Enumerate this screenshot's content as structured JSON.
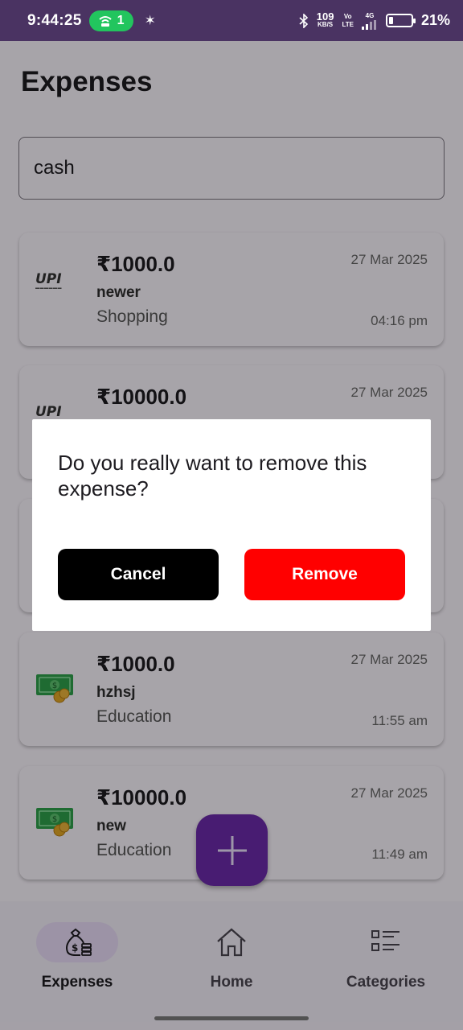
{
  "status_bar": {
    "time": "9:44:25",
    "hotspot_count": "1",
    "net_speed_value": "109",
    "net_speed_unit": "KB/S",
    "volte_top": "Vo",
    "volte_bottom": "LTE",
    "network": "4G",
    "battery_percent": "21%",
    "battery_level": 0.21,
    "background": "#4a3362"
  },
  "header": {
    "title": "Expenses"
  },
  "search": {
    "value": "cash",
    "placeholder": ""
  },
  "expenses": [
    {
      "amount": "₹1000.0",
      "note": "newer",
      "category": "Shopping",
      "date": "27 Mar 2025",
      "time": "04:16 pm",
      "icon": "upi-icon",
      "upi_label": "UPI"
    },
    {
      "amount": "₹10000.0",
      "note": "",
      "category": "",
      "date": "27 Mar 2025",
      "time": "",
      "icon": "upi-icon",
      "upi_label": "UPI"
    },
    {
      "amount": "",
      "note": "",
      "category": "",
      "date": "",
      "time": "",
      "icon": "cash-icon"
    },
    {
      "amount": "₹1000.0",
      "note": "hzhsj",
      "category": "Education",
      "date": "27 Mar 2025",
      "time": "11:55 am",
      "icon": "cash-icon"
    },
    {
      "amount": "₹10000.0",
      "note": "new",
      "category": "Education",
      "date": "27 Mar 2025",
      "time": "11:49 am",
      "icon": "cash-icon"
    }
  ],
  "fab": {
    "icon": "plus-icon",
    "color": "#6a2aa8"
  },
  "bottom_nav": {
    "items": [
      {
        "label": "Expenses",
        "icon": "money-bag-icon",
        "active": true
      },
      {
        "label": "Home",
        "icon": "home-icon",
        "active": false
      },
      {
        "label": "Categories",
        "icon": "categories-icon",
        "active": false
      }
    ]
  },
  "dialog": {
    "message": "Do you really want to remove this expense?",
    "cancel_label": "Cancel",
    "remove_label": "Remove",
    "cancel_color": "#000000",
    "remove_color": "#ff0000"
  }
}
